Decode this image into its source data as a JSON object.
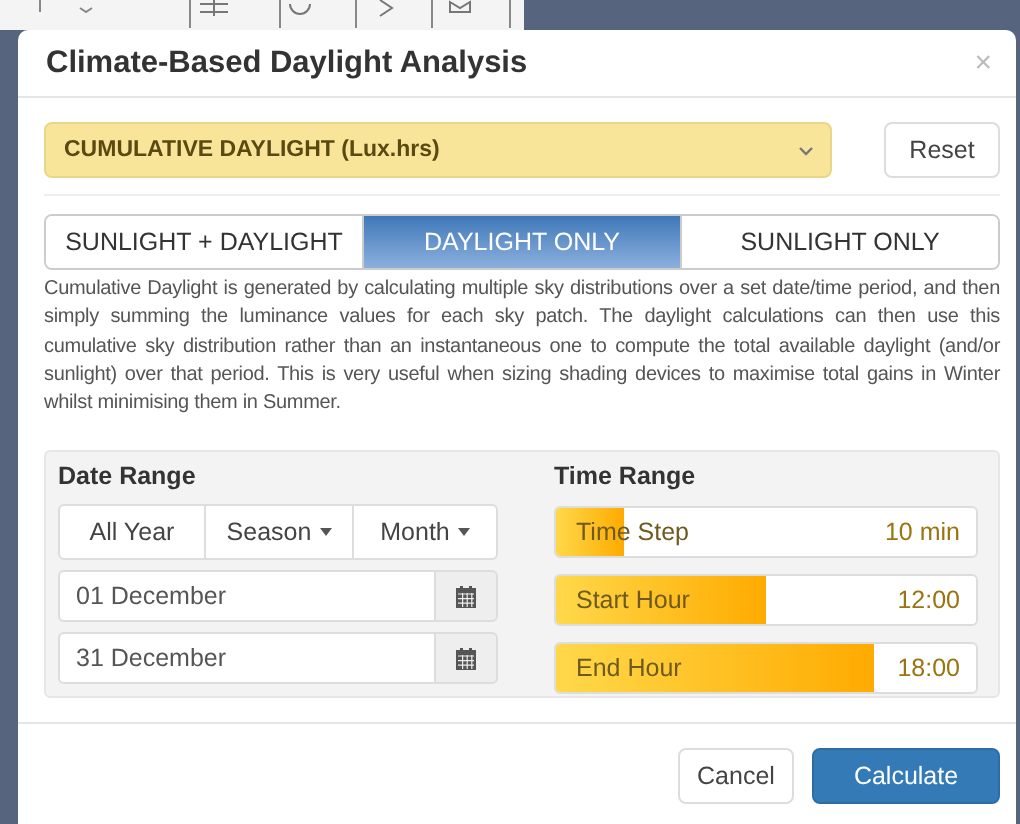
{
  "dialog": {
    "title": "Climate-Based Daylight Analysis",
    "close": "×",
    "metric": {
      "value": "CUMULATIVE DAYLIGHT (Lux.hrs)"
    },
    "reset": "Reset",
    "modes": [
      {
        "label": "SUNLIGHT + DAYLIGHT",
        "selected": false
      },
      {
        "label": "DAYLIGHT ONLY",
        "selected": true
      },
      {
        "label": "SUNLIGHT ONLY",
        "selected": false
      }
    ],
    "description": "Cumulative Daylight is generated by calculating multiple sky distributions over a set date/time period, and then simply summing the luminance values for each sky patch. The daylight calculations can then use this cumulative sky distribution rather than an instantaneous one to compute the total available daylight (and/or sunlight) over that period. This is very useful when sizing shading devices to maximise total gains in Winter whilst minimising them in Summer.",
    "date_range": {
      "heading": "Date Range",
      "presets": [
        {
          "label": "All Year",
          "dropdown": false
        },
        {
          "label": "Season",
          "dropdown": true
        },
        {
          "label": "Month",
          "dropdown": true
        }
      ],
      "start": "01 December",
      "end": "31 December"
    },
    "time_range": {
      "heading": "Time Range",
      "sliders": [
        {
          "label": "Time Step",
          "reading": "10 min",
          "level": 0.16
        },
        {
          "label": "Start Hour",
          "reading": "12:00",
          "level": 0.5
        },
        {
          "label": "End Hour",
          "reading": "18:00",
          "level": 0.755
        }
      ]
    },
    "buttons": [
      {
        "label": "Cancel",
        "kind": "default"
      },
      {
        "label": "Calculate",
        "kind": "primary"
      }
    ]
  }
}
